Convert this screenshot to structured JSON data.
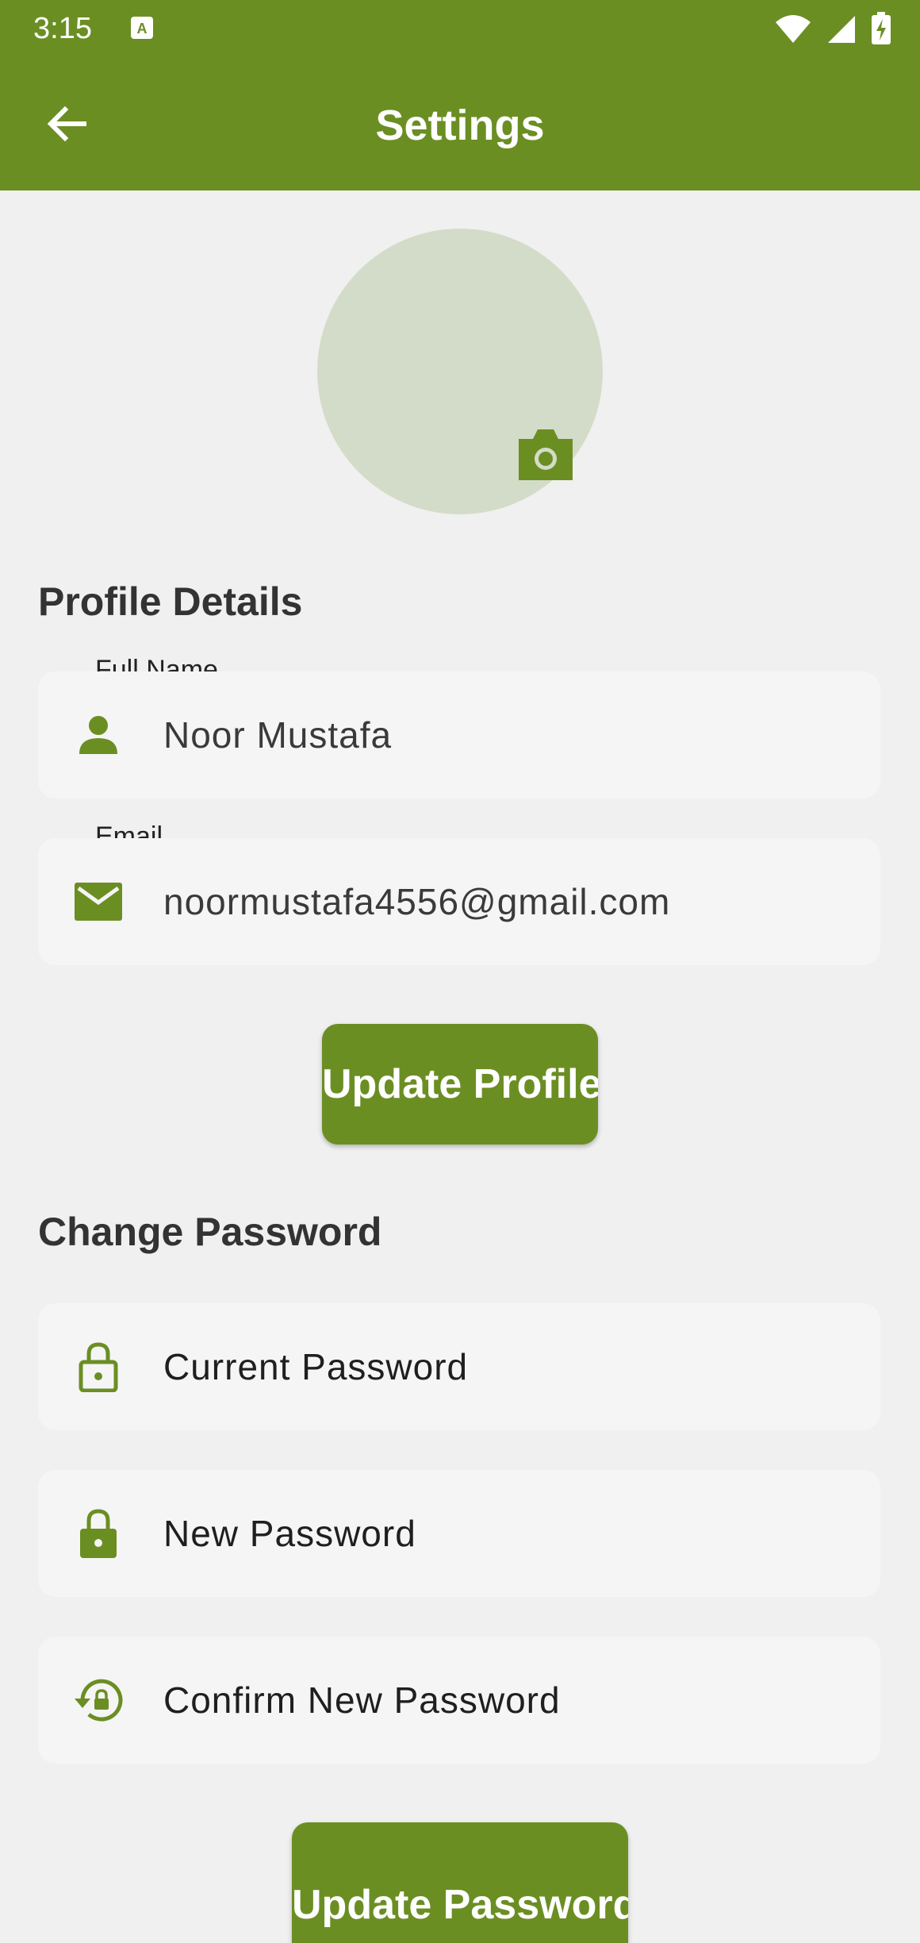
{
  "status_bar": {
    "time": "3:15"
  },
  "app_bar": {
    "title": "Settings",
    "back_icon": "arrow-left-icon"
  },
  "avatar": {
    "camera_icon": "camera-icon"
  },
  "profile": {
    "section_title": "Profile Details",
    "full_name_label": "Full Name",
    "full_name_value": "Noor Mustafa",
    "email_label": "Email",
    "email_value": "noormustafa4556@gmail.com",
    "update_button": "Update Profile"
  },
  "password": {
    "section_title": "Change Password",
    "current_placeholder": "Current Password",
    "new_placeholder": "New Password",
    "confirm_placeholder": "Confirm New Password",
    "update_button": "Update Password"
  },
  "colors": {
    "primary": "#6b8e23",
    "avatar_bg": "#d3dcc8",
    "field_bg": "#f5f5f5",
    "page_bg": "#f0f0f0"
  }
}
